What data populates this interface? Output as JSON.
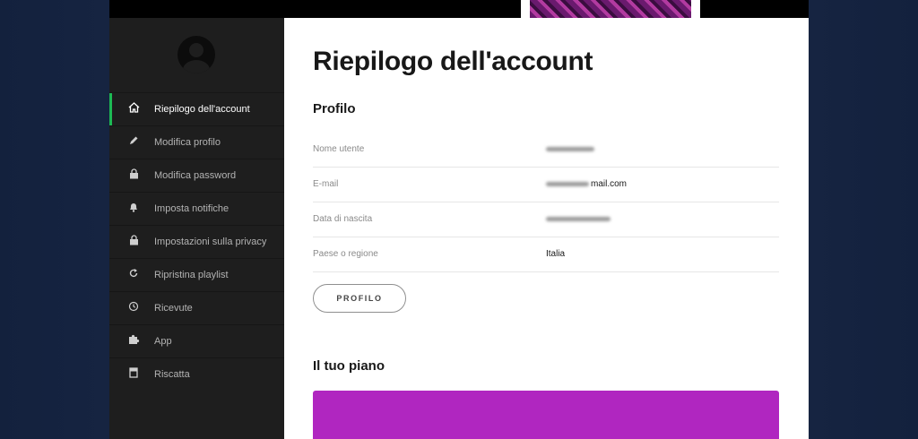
{
  "sidebar": {
    "items": [
      {
        "label": "Riepilogo dell'account",
        "icon": "home-icon",
        "active": true
      },
      {
        "label": "Modifica profilo",
        "icon": "pencil-icon",
        "active": false
      },
      {
        "label": "Modifica password",
        "icon": "lock-icon",
        "active": false
      },
      {
        "label": "Imposta notifiche",
        "icon": "bell-icon",
        "active": false
      },
      {
        "label": "Impostazioni sulla privacy",
        "icon": "lock-icon",
        "active": false
      },
      {
        "label": "Ripristina playlist",
        "icon": "refresh-icon",
        "active": false
      },
      {
        "label": "Ricevute",
        "icon": "clock-icon",
        "active": false
      },
      {
        "label": "App",
        "icon": "puzzle-icon",
        "active": false
      },
      {
        "label": "Riscatta",
        "icon": "card-icon",
        "active": false
      }
    ]
  },
  "main": {
    "title": "Riepilogo dell'account",
    "profile_section": {
      "heading": "Profilo",
      "rows": [
        {
          "label": "Nome utente",
          "value": ""
        },
        {
          "label": "E-mail",
          "value": "mail.com"
        },
        {
          "label": "Data di nascita",
          "value": ""
        },
        {
          "label": "Paese o regione",
          "value": "Italia"
        }
      ],
      "button_label": "PROFILO"
    },
    "plan_section": {
      "heading": "Il tuo piano"
    }
  },
  "colors": {
    "accent": "#1db954",
    "sidebar_bg": "#1e1e1e",
    "plan_card": "#b026c0",
    "page_bg": "#1a2744"
  }
}
